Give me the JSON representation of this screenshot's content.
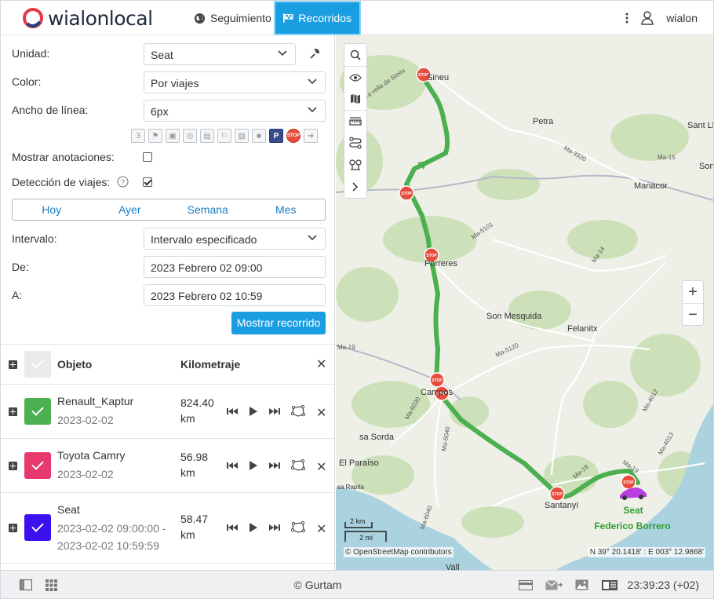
{
  "header": {
    "logo_text": "wialonlocal",
    "nav": [
      {
        "label": "Seguimiento",
        "icon": "globe-icon"
      },
      {
        "label": "Recorridos",
        "icon": "route-flag-icon",
        "active": true
      }
    ],
    "user_name": "wialon"
  },
  "panel": {
    "unit_label": "Unidad:",
    "unit_value": "Seat",
    "color_label": "Color:",
    "color_value": "Por viajes",
    "width_label": "Ancho de línea:",
    "width_value": "6px",
    "annotations_label": "Mostrar anotaciones:",
    "annotations_checked": false,
    "trips_label": "Detección de viajes:",
    "trips_checked": true,
    "marker_icons": [
      "3",
      "flag",
      "fuel",
      "wheel",
      "pump",
      "flag2",
      "image",
      "video",
      "P",
      "STOP",
      "arrow"
    ],
    "periods": [
      "Hoy",
      "Ayer",
      "Semana",
      "Mes"
    ],
    "interval_label": "Intervalo:",
    "interval_value": "Intervalo especificado",
    "from_label": "De:",
    "from_value": "2023 Febrero 02 09:00",
    "to_label": "A:",
    "to_value": "2023 Febrero 02 10:59",
    "show_button": "Mostrar recorrido"
  },
  "table": {
    "col_object": "Objeto",
    "col_mileage": "Kilometraje",
    "rows": [
      {
        "name": "Renault_Kaptur",
        "date": "2023-02-02",
        "km_value": "824.40",
        "km_unit": "km",
        "color": "#4caf50"
      },
      {
        "name": "Toyota Camry",
        "date": "2023-02-02",
        "km_value": "56.98",
        "km_unit": "km",
        "color": "#e63a6e"
      },
      {
        "name": "Seat",
        "date": "2023-02-02 09:00:00 -",
        "date2": "2023-02-02 10:59:59",
        "km_value": "58.47",
        "km_unit": "km",
        "color": "#3d10f0"
      }
    ]
  },
  "map": {
    "places": [
      "Sineu",
      "Petra",
      "Sant Ll",
      "Manacor",
      "Porreres",
      "Son Mesquida",
      "Felanitx",
      "Campos",
      "sa Sorda",
      "El Paraíso",
      "Santanyí",
      "sa Rapita",
      "Vall",
      "Son"
    ],
    "road_labels": [
      "Ma-3320",
      "Ma-15",
      "Ma-5101",
      "Ma-14",
      "Ma-5120",
      "Ma-19",
      "Ma-6030",
      "Ma-6040",
      "Ma-4012",
      "Ma-4013",
      "Ma-19",
      "Ma-6040",
      "Ma-19"
    ],
    "road_text": "ra vella de Sineu",
    "scale_km": "2 km",
    "scale_mi": "2 mi",
    "attribution": "© OpenStreetMap contributors",
    "coordinates": "N 39° 20.1418' : E 003° 12.9868'",
    "unit_label": "Seat",
    "driver_label": "Federico Borrero",
    "track_color": "#4caf50",
    "stop_color": "#e74c3c"
  },
  "footer": {
    "copyright": "© Gurtam",
    "time": "23:39:23 (+02)"
  },
  "colors": {
    "accent": "#1a9ee2",
    "link": "#1a7cc7"
  }
}
